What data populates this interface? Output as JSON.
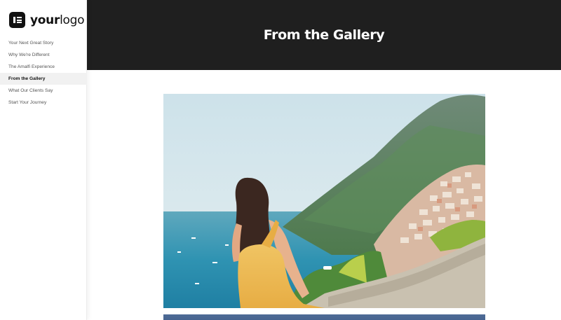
{
  "logo": {
    "mark_icon": "elementor-logo-icon",
    "text_bold": "your",
    "text_regular": "logo"
  },
  "nav": {
    "items": [
      {
        "label": "Your Next Great Story",
        "active": false
      },
      {
        "label": "Why We're Different",
        "active": false
      },
      {
        "label": "The Amalfi Experience",
        "active": false
      },
      {
        "label": "From the Gallery",
        "active": true
      },
      {
        "label": "What Our Clients Say",
        "active": false
      },
      {
        "label": "Start Your Journey",
        "active": false
      }
    ]
  },
  "header": {
    "title": "From the Gallery",
    "background": "#1f1f1f"
  },
  "gallery": {
    "images": [
      "woman-overlooking-positano-photo",
      "coastline-photo"
    ]
  }
}
